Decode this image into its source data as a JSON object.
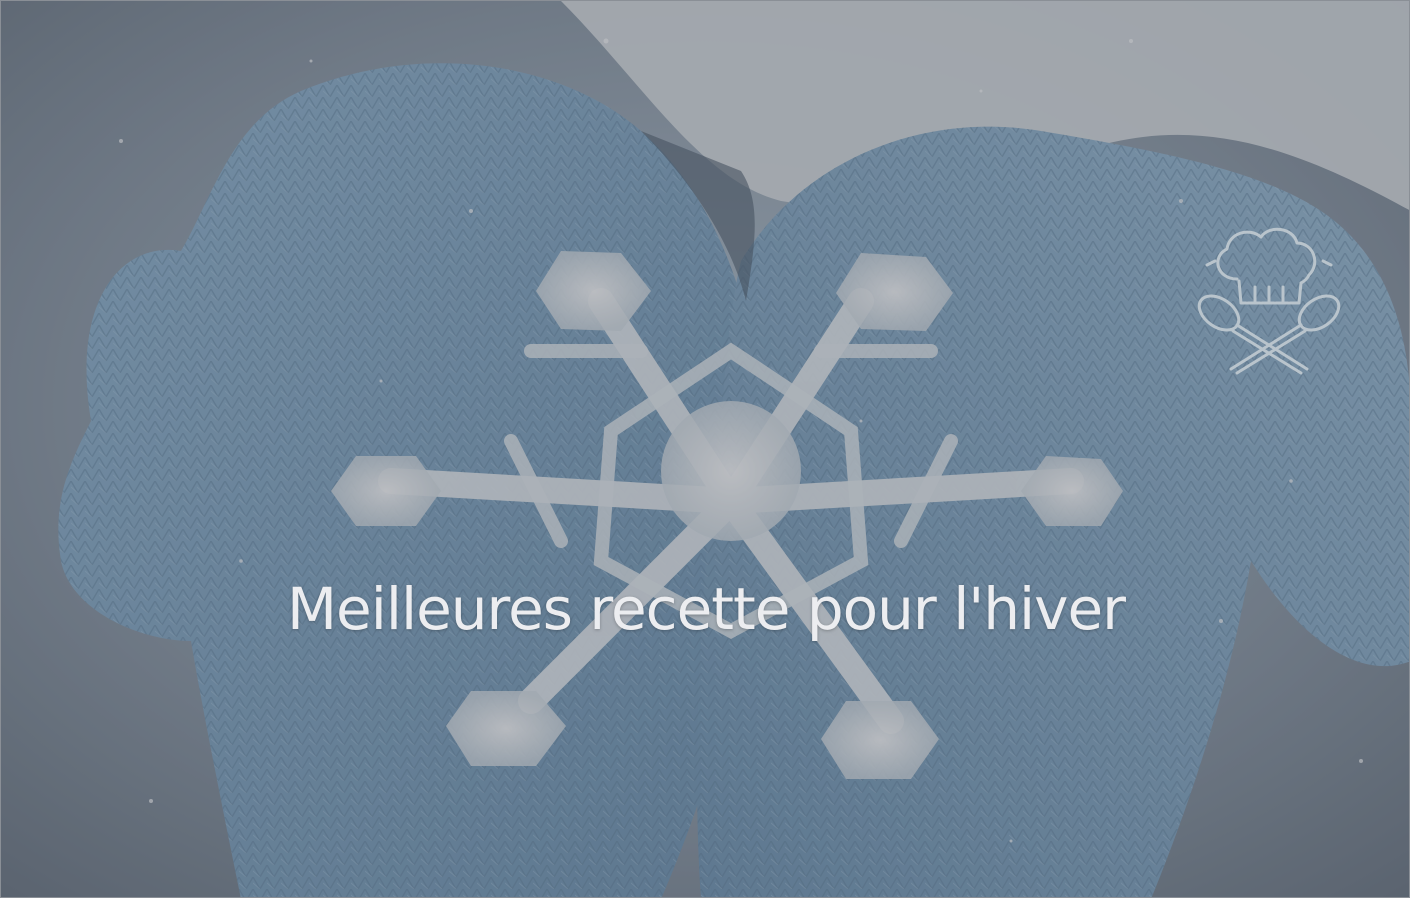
{
  "hero": {
    "title": "Meilleures recette pour l'hiver",
    "logo_icon": "chef-hat-crossed-spoons-icon",
    "background_description_icon": "snowflake-in-knitted-mittens"
  },
  "colors": {
    "mitten_blue": "#8fb4cf",
    "title_text": "#ecedf0",
    "logo_stroke": "#b9c4cc",
    "snow_white": "#e6ebee"
  }
}
